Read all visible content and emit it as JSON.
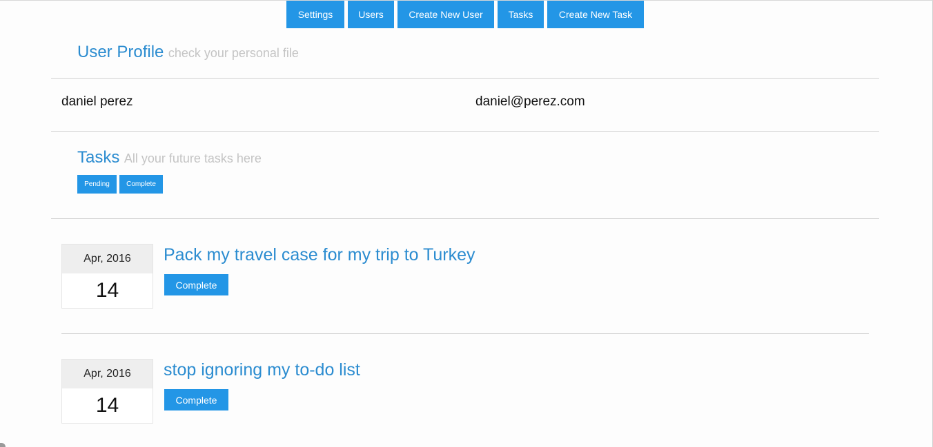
{
  "nav": {
    "items": [
      {
        "label": "Settings"
      },
      {
        "label": "Users"
      },
      {
        "label": "Create New User"
      },
      {
        "label": "Tasks"
      },
      {
        "label": "Create New Task"
      }
    ]
  },
  "profile": {
    "title": "User Profile",
    "subtitle": "check your personal file",
    "name": "daniel perez",
    "email": "daniel@perez.com"
  },
  "tasks_section": {
    "title": "Tasks",
    "subtitle": "All your future tasks here",
    "filters": [
      {
        "label": "Pending"
      },
      {
        "label": "Complete"
      }
    ]
  },
  "tasks": [
    {
      "month": "Apr, 2016",
      "day": "14",
      "title": "Pack my travel case for my trip to Turkey",
      "action_label": "Complete"
    },
    {
      "month": "Apr, 2016",
      "day": "14",
      "title": "stop ignoring my to-do list",
      "action_label": "Complete"
    }
  ],
  "colors": {
    "accent": "#2396e6",
    "heading": "#2b8cd0",
    "subtext": "#c4c4c4"
  }
}
